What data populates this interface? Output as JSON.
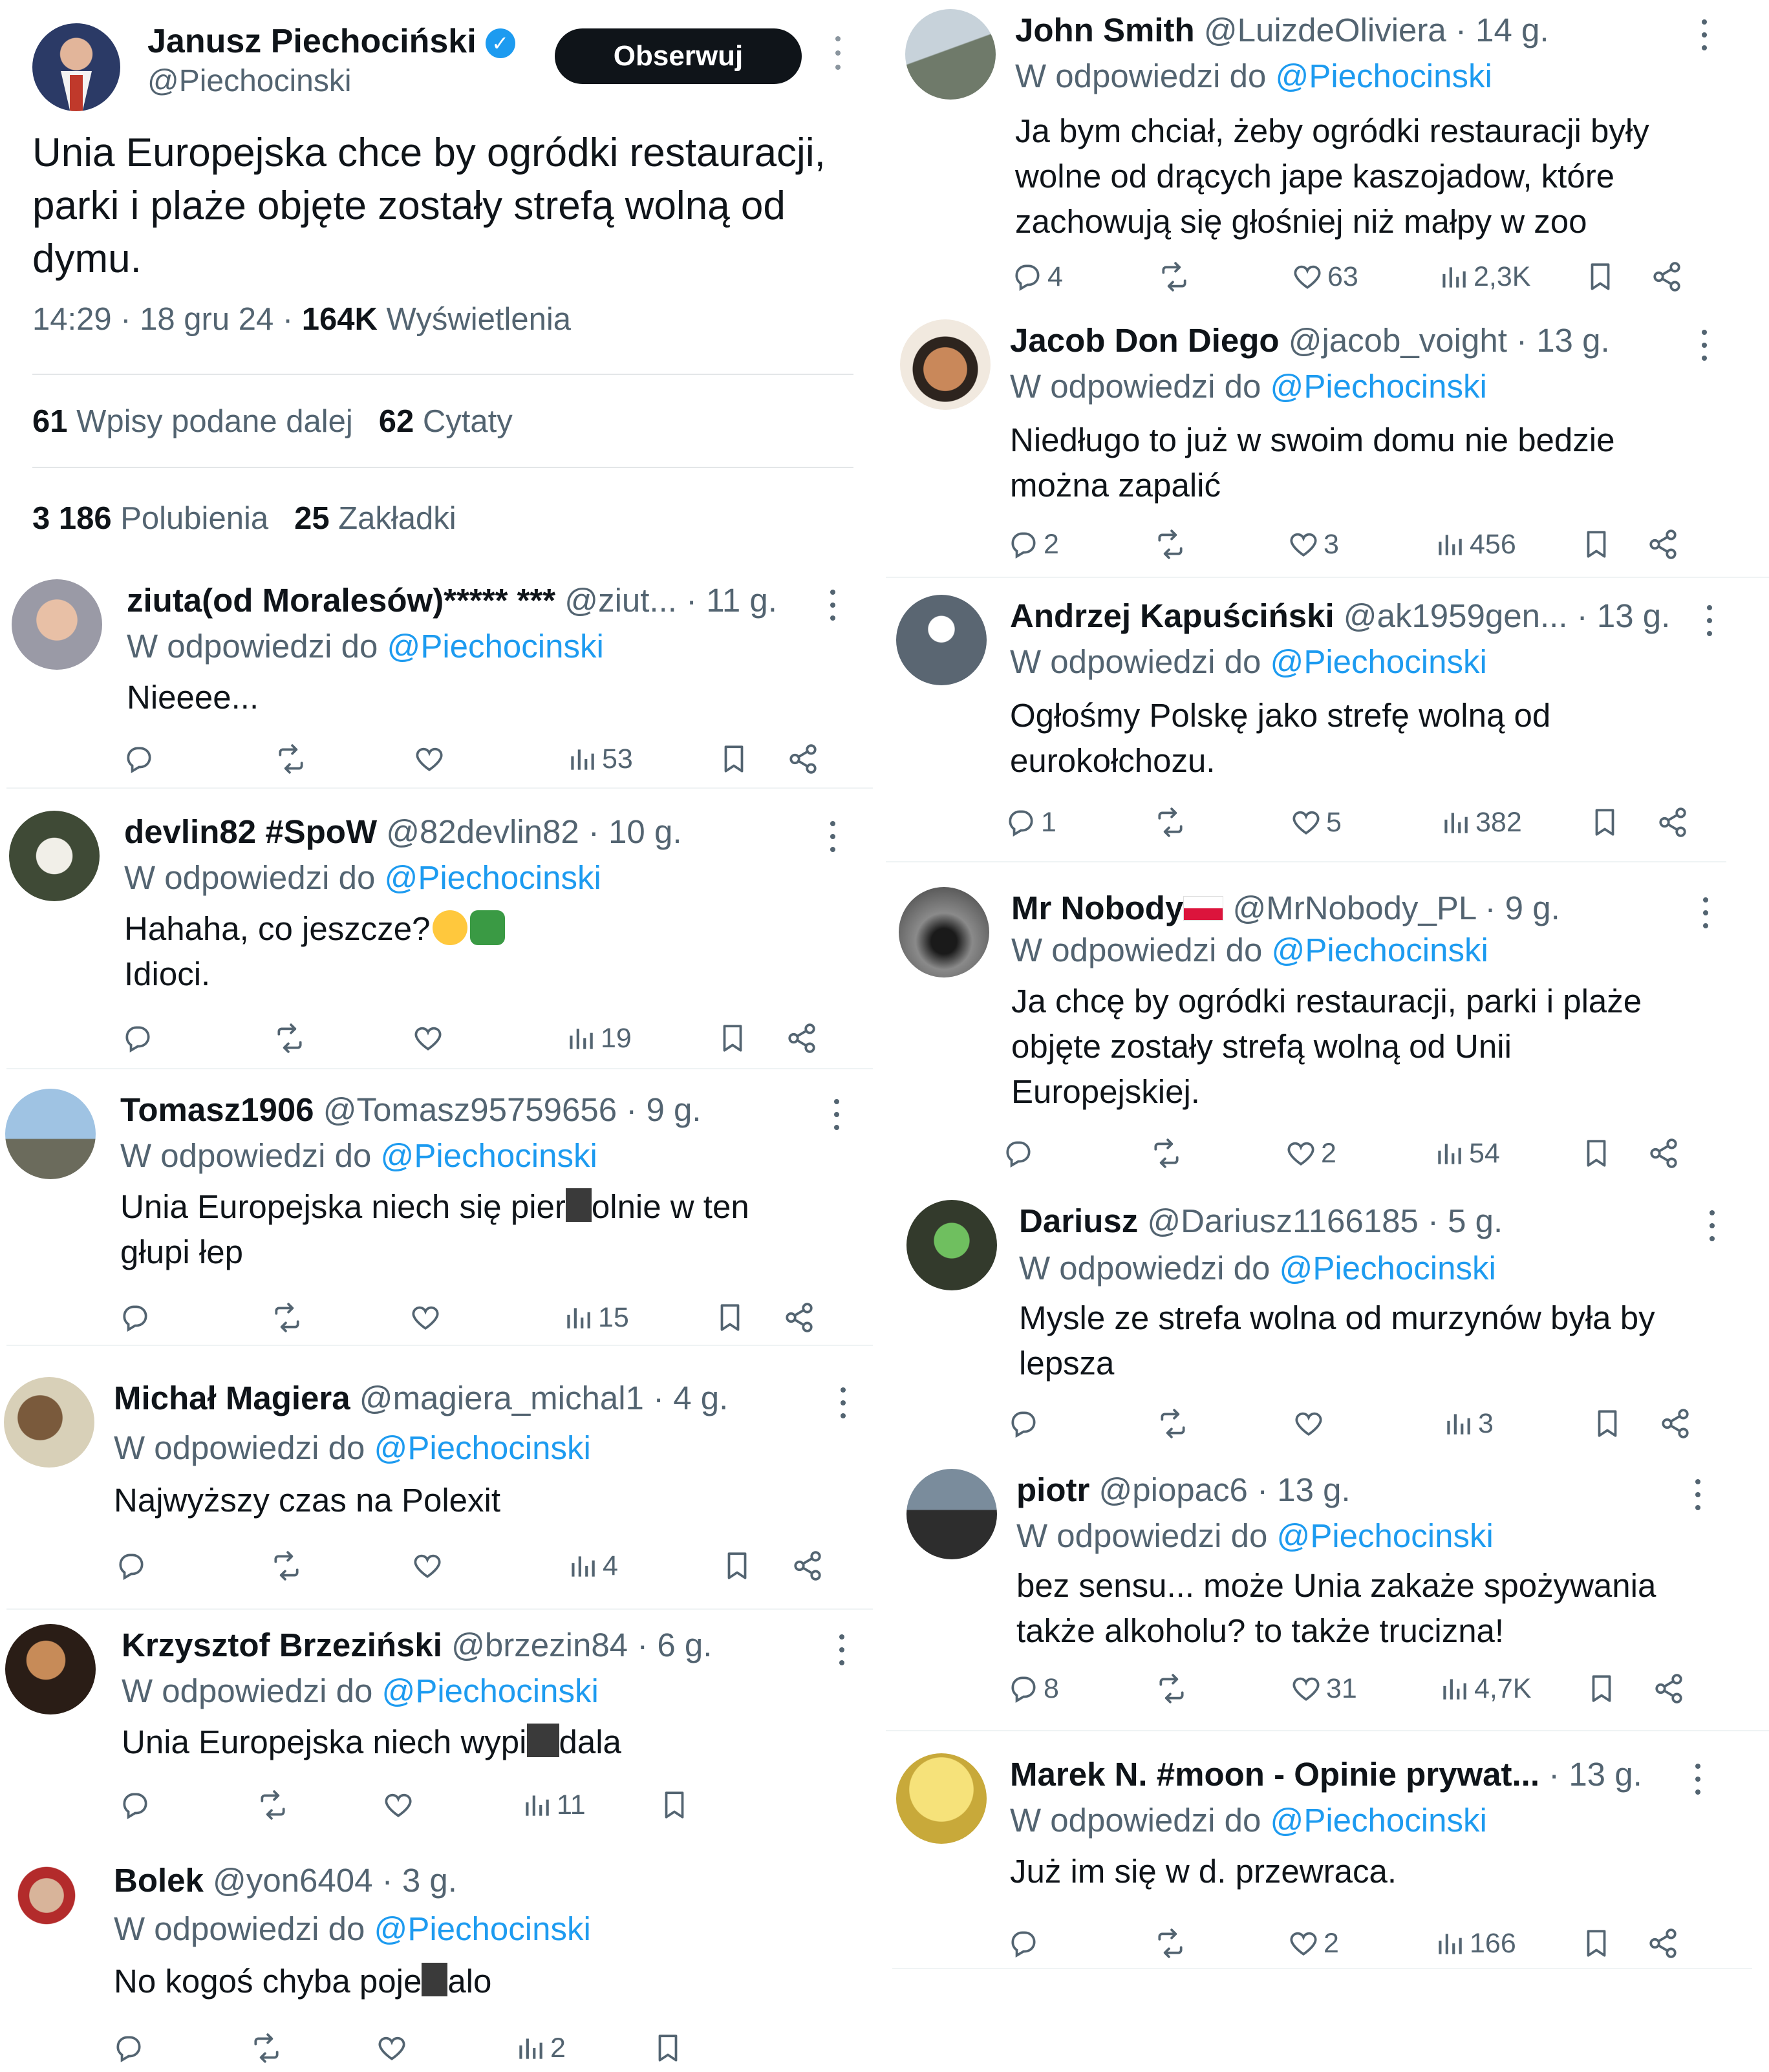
{
  "main_tweet": {
    "name": "Janusz Piechociński",
    "handle": "@Piechocinski",
    "follow_label": "Obserwuj",
    "verified_glyph": "✓",
    "text": "Unia Europejska chce by ogródki restauracji, parki i plaże objęte zostały strefą wolną od dymu.",
    "time": "14:29 · 18 gru 24 · ",
    "views_count": "164K",
    "views_label": " Wyświetlenia",
    "reposts_count": "61",
    "reposts_label": " Wpisy podane dalej",
    "quotes_count": "62",
    "quotes_label": " Cytaty",
    "likes_count": "3 186",
    "likes_label": " Polubienia",
    "bookmarks_count": "25",
    "bookmarks_label": " Zakładki"
  },
  "reply_prefix": "W odpowiedzi do ",
  "mention": "@Piechocinski",
  "left_replies": [
    {
      "name": "ziuta(od Moralesów)***** ***",
      "handle": " @ziut...",
      "time": " · 11 g.",
      "text": "Nieeee...",
      "replies": "",
      "likes": "",
      "views": "53"
    },
    {
      "name": "devlin82 #SpoW",
      "handle": " @82devlin82",
      "time": " · 10 g.",
      "text_line1": "Hahaha, co jeszcze?",
      "text_line2": "Idioci.",
      "replies": "",
      "likes": "",
      "views": "19"
    },
    {
      "name": "Tomasz1906",
      "handle": " @Tomasz95759656",
      "time": " · 9 g.",
      "text_a": "Unia Europejska niech się pier",
      "text_b": "olnie w ten",
      "text_c": "głupi łep",
      "replies": "",
      "likes": "",
      "views": "15"
    },
    {
      "name": "Michał Magiera",
      "handle": " @magiera_michal1",
      "time": " · 4 g.",
      "text": "Najwyższy czas na Polexit",
      "replies": "",
      "likes": "",
      "views": "4"
    },
    {
      "name": "Krzysztof Brzeziński",
      "handle": " @brzezin84",
      "time": " · 6 g.",
      "text_a": "Unia Europejska niech wypi",
      "text_b": "dala",
      "replies": "",
      "likes": "",
      "views": "11"
    },
    {
      "name": "Bolek",
      "handle": " @yon6404",
      "time": " · 3 g.",
      "text_a": "No kogoś chyba poje",
      "text_b": "alo",
      "replies": "",
      "likes": "",
      "views": "2"
    }
  ],
  "right_replies": [
    {
      "name": "John Smith",
      "handle": " @LuizdeOliviera",
      "time": " · 14 g.",
      "text": "Ja bym chciał, żeby ogródki restauracji były wolne od drących jape kaszojadow, które zachowują się głośniej niż małpy w zoo",
      "replies": "4",
      "likes": "63",
      "views": "2,3K"
    },
    {
      "name": "Jacob Don Diego",
      "handle": " @jacob_voight",
      "time": " · 13 g.",
      "text": "Niedługo to już w swoim  domu nie bedzie można zapalić",
      "replies": "2",
      "likes": "3",
      "views": "456"
    },
    {
      "name": "Andrzej Kapuściński",
      "handle": " @ak1959gen...",
      "time": " · 13 g.",
      "text": "Ogłośmy Polskę jako strefę wolną od eurokołchozu.",
      "replies": "1",
      "likes": "5",
      "views": "382"
    },
    {
      "name": "Mr Nobody",
      "handle": " @MrNobody_PL",
      "time": " · 9 g.",
      "text": "Ja chcę by ogródki restauracji, parki i plaże objęte zostały strefą wolną od Unii Europejskiej.",
      "replies": "",
      "likes": "2",
      "views": "54"
    },
    {
      "name": "Dariusz",
      "handle": " @Dariusz1166185",
      "time": " · 5 g.",
      "text": "Mysle ze strefa wolna od murzynów była by lepsza",
      "replies": "",
      "likes": "",
      "views": "3"
    },
    {
      "name": "piotr",
      "handle": " @piopac6",
      "time": " · 13 g.",
      "text": "bez sensu... może Unia zakaże spożywania także alkoholu? to także trucizna!",
      "replies": "8",
      "likes": "31",
      "views": "4,7K"
    },
    {
      "name": "Marek N. #moon - Opinie prywat...",
      "handle": "",
      "time": " · 13 g.",
      "text": "Już im się w d. przewraca.",
      "replies": "",
      "likes": "2",
      "views": "166"
    }
  ],
  "colors": {
    "text": "#0f1419",
    "muted": "#536471",
    "link": "#1d9bf0",
    "button": "#0f1419"
  },
  "icons": [
    "reply-icon",
    "repost-icon",
    "like-icon",
    "views-icon",
    "bookmark-icon",
    "share-icon",
    "more-icon",
    "verified-icon",
    "polish-flag-icon",
    "grin-emoji-icon",
    "facepalm-emoji-icon"
  ]
}
